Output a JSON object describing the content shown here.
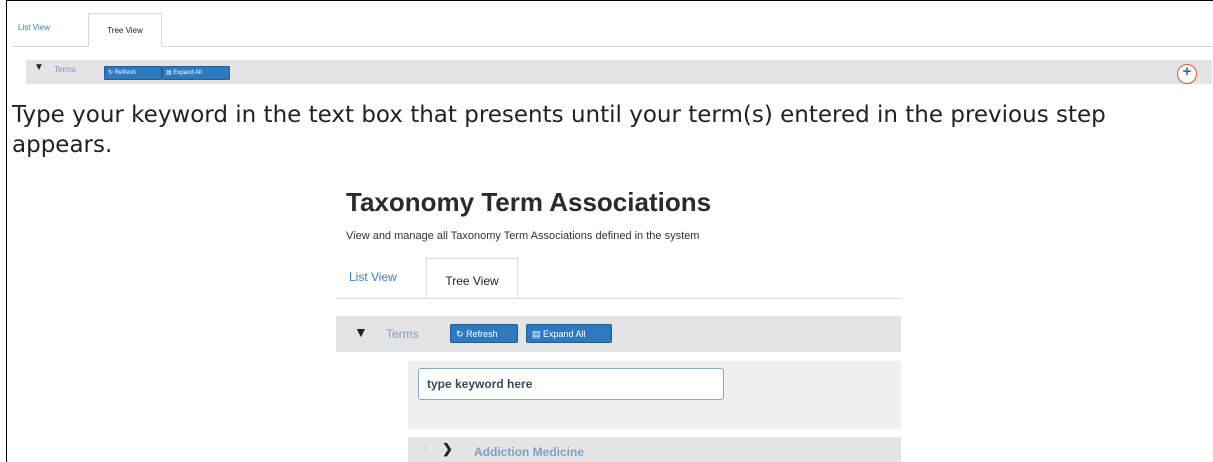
{
  "top_ui": {
    "tabs": [
      {
        "label": "List View",
        "active": false
      },
      {
        "label": "Tree View",
        "active": true
      }
    ],
    "terms_label": "Terms",
    "refresh_label": "Refresh",
    "expand_label": "Expand All",
    "chevron_icon": "chevron-down-icon",
    "add_icon": "plus-icon"
  },
  "instruction": "Type your keyword in the text box that presents until your term(s) entered in the previous step appears.",
  "panel": {
    "title": "Taxonomy Term Associations",
    "subtitle": "View and manage all Taxonomy Term Associations defined in the system",
    "tabs": [
      {
        "label": "List View",
        "active": false
      },
      {
        "label": "Tree View",
        "active": true
      }
    ],
    "terms_label": "Terms",
    "refresh_label": "Refresh",
    "expand_label": "Expand All",
    "search": {
      "value": "type keyword here",
      "placeholder": ""
    },
    "tree_items": [
      {
        "label": "Addiction Medicine",
        "icon": "chevron-right-icon"
      }
    ]
  },
  "colors": {
    "accent": "#2d7ac0",
    "link": "#3e7bbf",
    "bar": "#e4e4e4",
    "add_ring": "#e0552b"
  }
}
